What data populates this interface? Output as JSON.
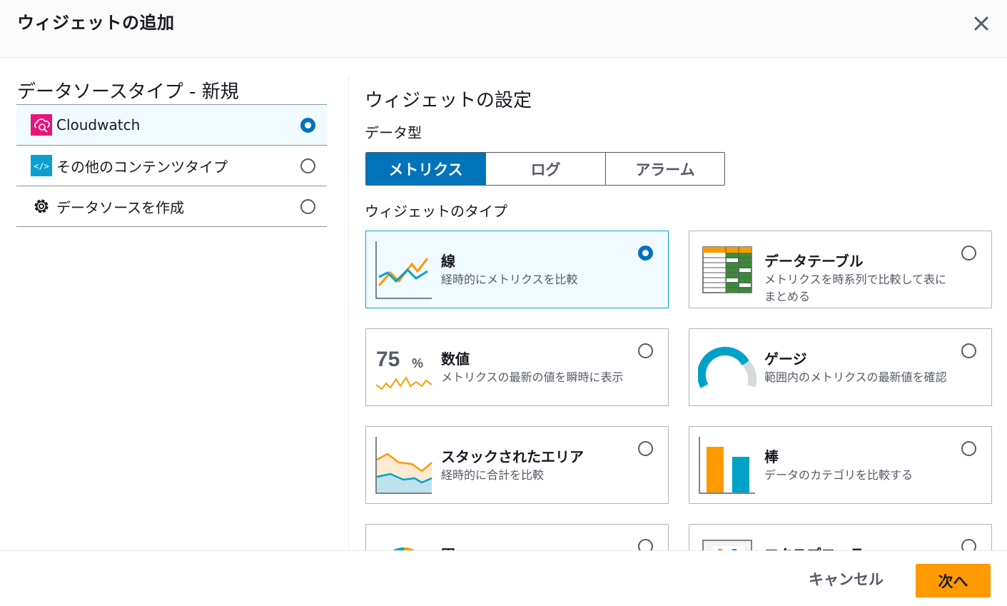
{
  "header": {
    "title": "ウィジェットの追加"
  },
  "left": {
    "title": "データソースタイプ - 新規",
    "items": [
      {
        "label": "Cloudwatch",
        "icon": "cloudwatch-icon",
        "selected": true
      },
      {
        "label": "その他のコンテンツタイプ",
        "icon": "code-icon",
        "selected": false
      },
      {
        "label": "データソースを作成",
        "icon": "gear-icon",
        "selected": false
      }
    ]
  },
  "right": {
    "title": "ウィジェットの設定",
    "datatype_label": "データ型",
    "segments": [
      {
        "label": "メトリクス",
        "active": true
      },
      {
        "label": "ログ",
        "active": false
      },
      {
        "label": "アラーム",
        "active": false
      }
    ],
    "widget_type_label": "ウィジェットのタイプ",
    "thumb_number": "75",
    "thumb_percent": "%",
    "cards": [
      {
        "title": "線",
        "desc": "経時的にメトリクスを比較",
        "icon": "line-chart-icon",
        "selected": true
      },
      {
        "title": "データテーブル",
        "desc": "メトリクスを時系列で比較して表にまとめる",
        "icon": "data-table-icon",
        "selected": false
      },
      {
        "title": "数値",
        "desc": "メトリクスの最新の値を瞬時に表示",
        "icon": "number-icon",
        "selected": false
      },
      {
        "title": "ゲージ",
        "desc": "範囲内のメトリクスの最新値を確認",
        "icon": "gauge-icon",
        "selected": false
      },
      {
        "title": "スタックされたエリア",
        "desc": "経時的に合計を比較",
        "icon": "stacked-area-icon",
        "selected": false
      },
      {
        "title": "棒",
        "desc": "データのカテゴリを比較する",
        "icon": "bar-chart-icon",
        "selected": false
      },
      {
        "title": "円",
        "desc": "",
        "icon": "pie-chart-icon",
        "selected": false
      },
      {
        "title": "エクスプローラー",
        "desc": "",
        "icon": "explorer-icon",
        "selected": false
      }
    ]
  },
  "footer": {
    "cancel_label": "キャンセル",
    "next_label": "次へ"
  },
  "colors": {
    "primary": "#0073bb",
    "accent": "#ff9900",
    "cloudwatch": "#e7157b",
    "code": "#0c9fcf"
  }
}
